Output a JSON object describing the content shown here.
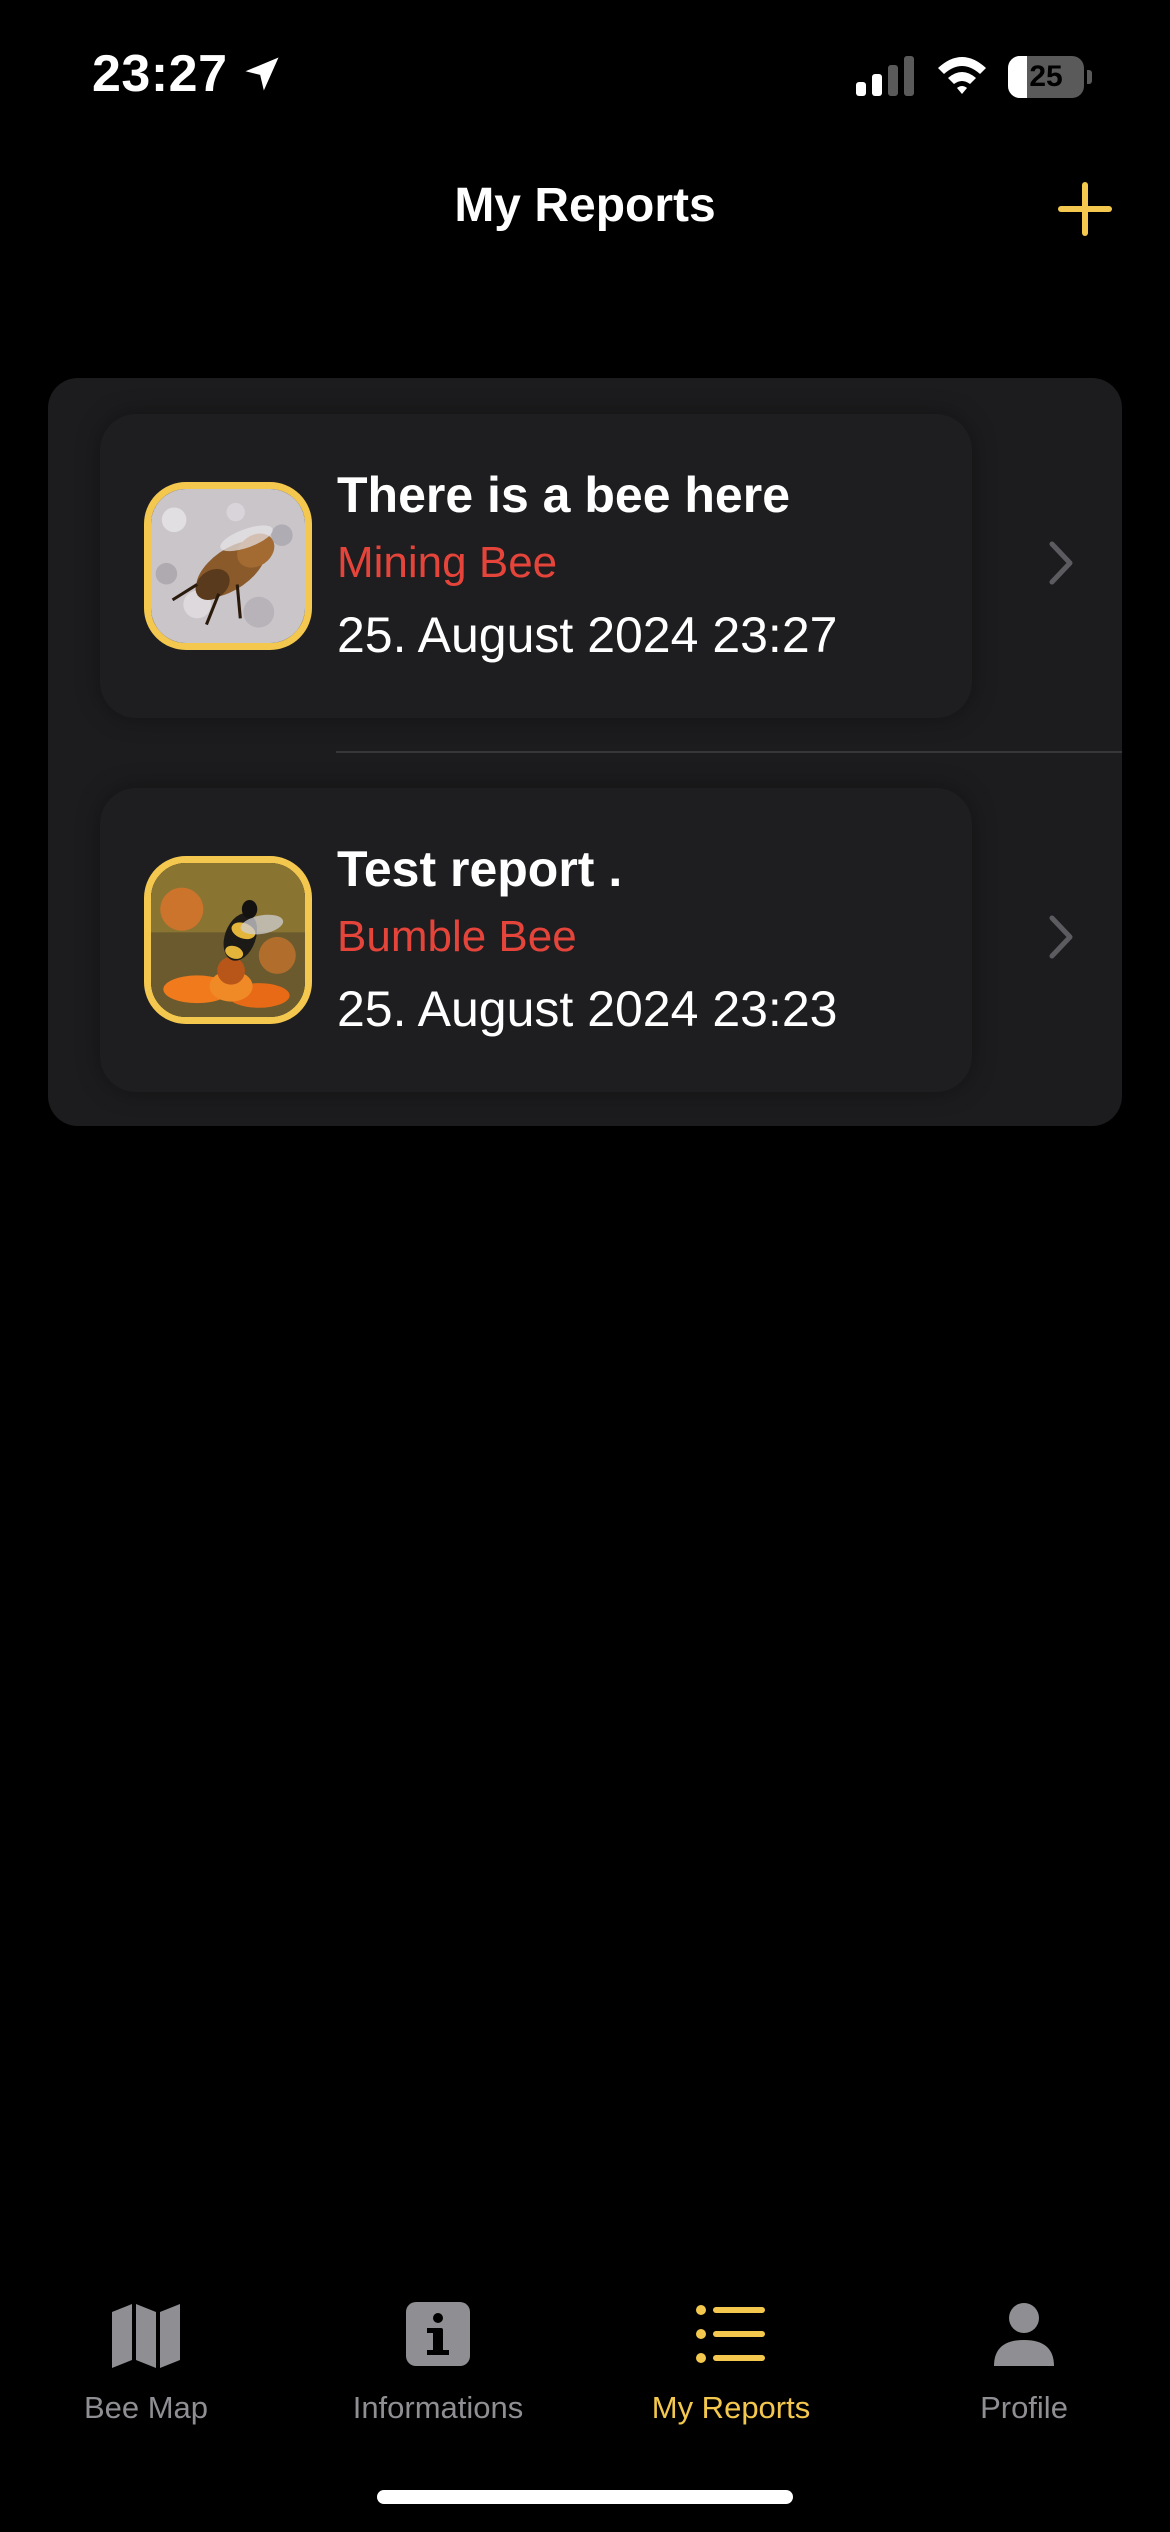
{
  "status_bar": {
    "time": "23:27",
    "battery_level": "25",
    "battery_fraction": 0.25,
    "icons": [
      "location-arrow-icon",
      "cellular-signal-icon",
      "wifi-icon",
      "battery-icon"
    ]
  },
  "header": {
    "title": "My Reports",
    "add_icon": "plus-icon",
    "accent_color": "#f4c84e"
  },
  "reports": [
    {
      "title": "There is a bee here",
      "species": "Mining Bee",
      "date": "25. August 2024  23:27",
      "species_color": "#e5443a"
    },
    {
      "title": "Test report .",
      "species": "Bumble Bee",
      "date": "25. August 2024  23:23",
      "species_color": "#e5443a"
    }
  ],
  "tab_bar": {
    "tabs": [
      {
        "label": "Bee Map",
        "icon": "map-icon",
        "active": false
      },
      {
        "label": "Informations",
        "icon": "info-icon",
        "active": false
      },
      {
        "label": "My Reports",
        "icon": "list-icon",
        "active": true
      },
      {
        "label": "Profile",
        "icon": "person-icon",
        "active": false
      }
    ]
  }
}
